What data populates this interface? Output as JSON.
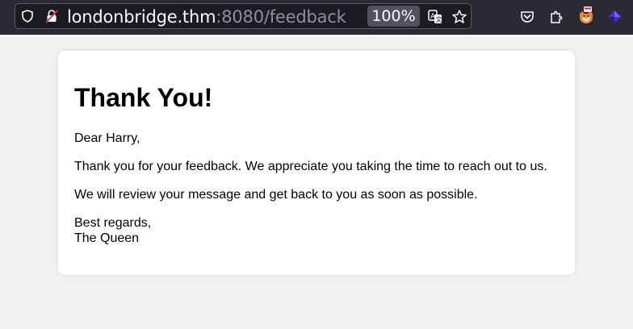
{
  "browser": {
    "url_host": "londonbridge.thm",
    "url_rest": ":8080/feedback",
    "zoom": "100%"
  },
  "icons": {
    "shield": "tracking-protection-icon",
    "lock": "insecure-lock-icon",
    "translate": "translate-icon",
    "bookmark": "star-icon",
    "pocket": "pocket-icon",
    "extensions": "extensions-icon",
    "foxyproxy": "foxyproxy-icon",
    "wappalyzer": "wappalyzer-icon"
  },
  "page": {
    "heading": "Thank You!",
    "greeting": "Dear Harry,",
    "thanks": "Thank you for your feedback. We appreciate you taking the time to reach out to us.",
    "review": "We will review your message and get back to you as soon as possible.",
    "closing": "Best regards,",
    "signature": "The Queen"
  },
  "colors": {
    "toolbar_bg": "#2b2a33",
    "page_bg": "#f1f1f1",
    "card_bg": "#ffffff"
  }
}
